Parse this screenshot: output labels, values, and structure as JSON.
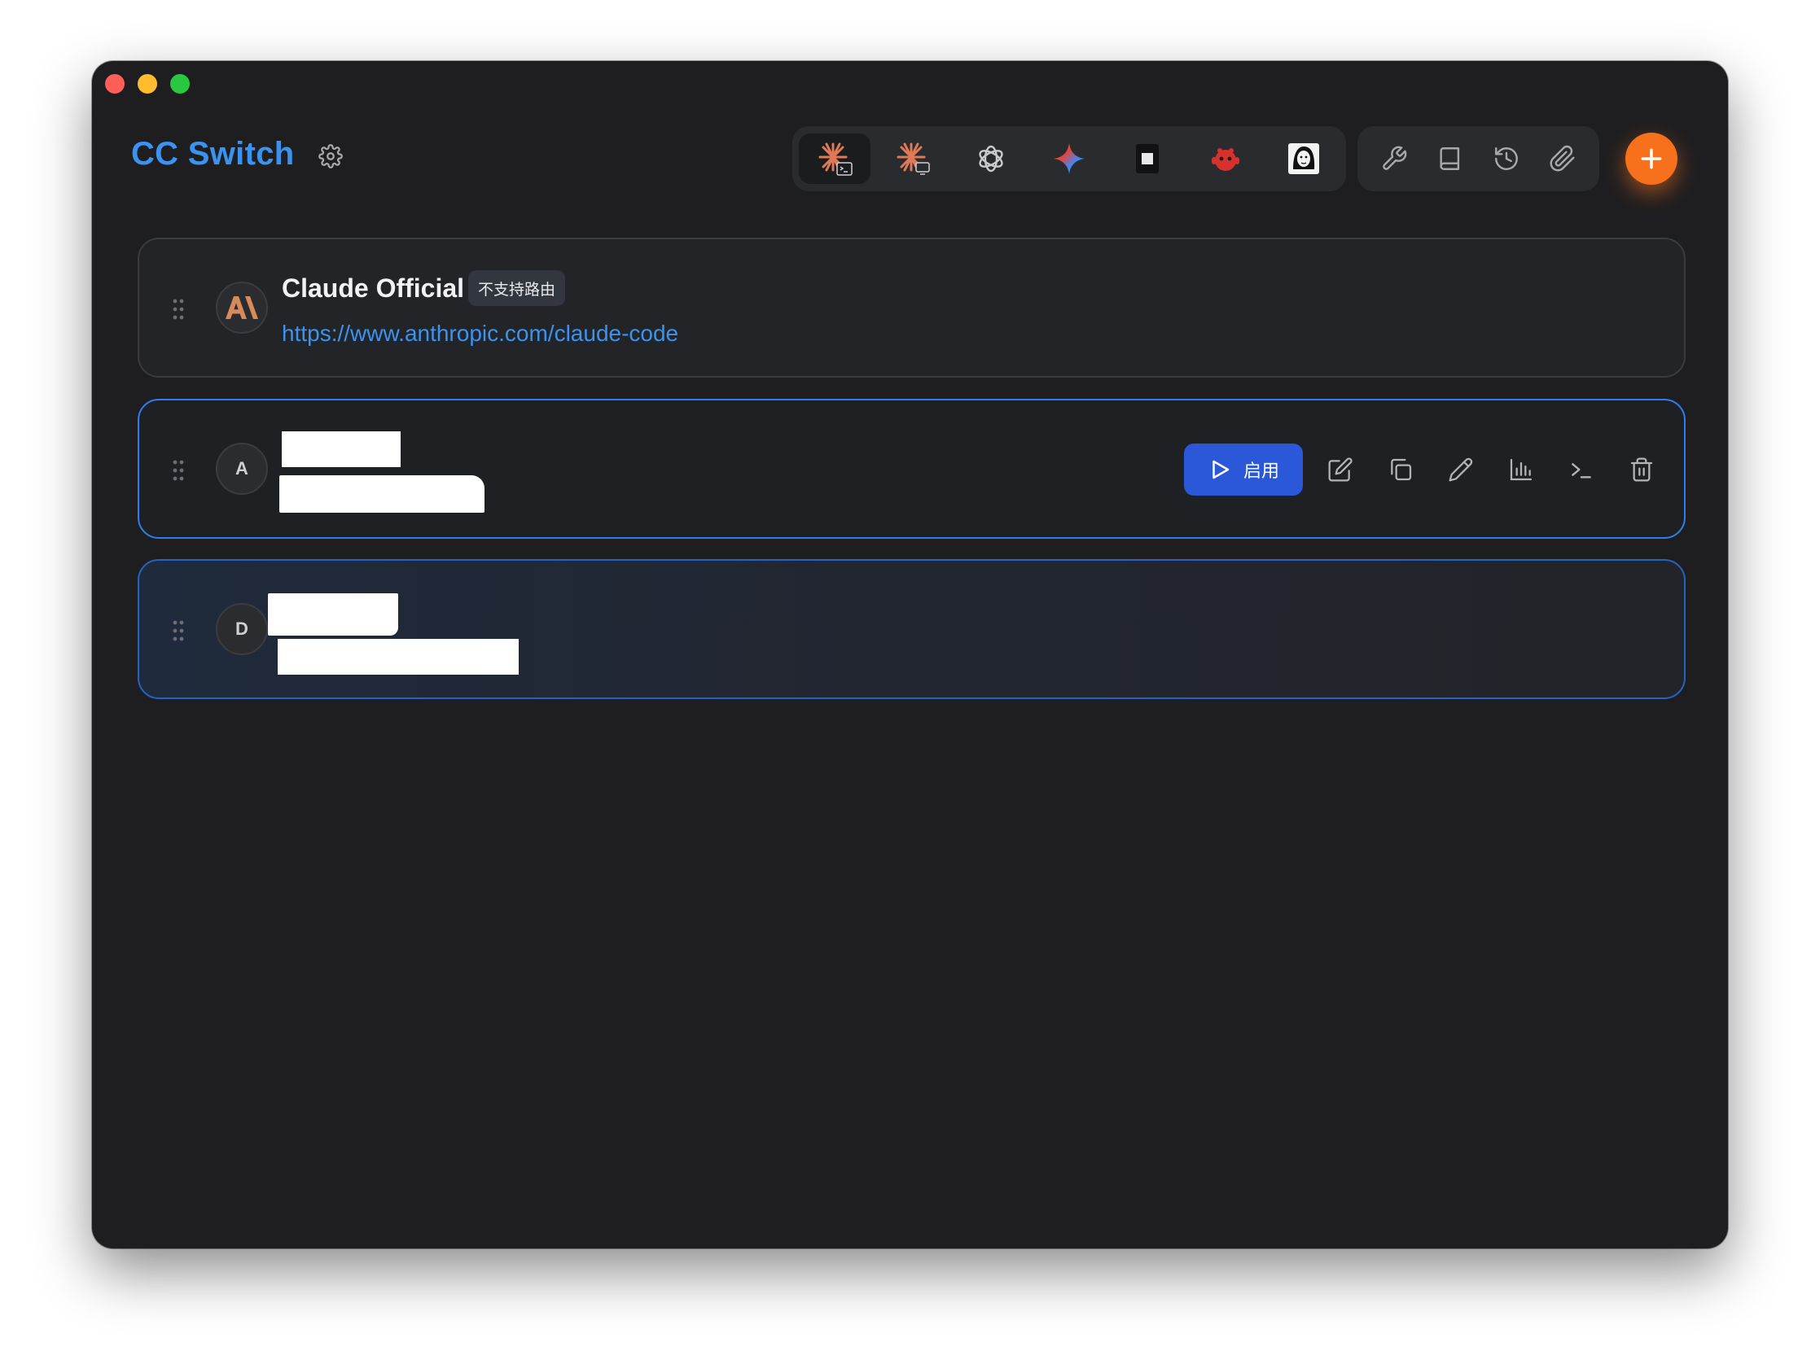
{
  "window": {
    "title": "CC Switch",
    "traffic_lights": [
      "close",
      "minimize",
      "maximize"
    ]
  },
  "header": {
    "settings_icon": "gear-icon",
    "app_switcher": [
      {
        "name": "claude-code",
        "icon": "claude-terminal-icon",
        "active": true
      },
      {
        "name": "claude-desktop",
        "icon": "claude-desktop-icon",
        "active": false
      },
      {
        "name": "openai-codex",
        "icon": "openai-icon",
        "active": false
      },
      {
        "name": "gemini",
        "icon": "gemini-icon",
        "active": false
      },
      {
        "name": "app-5",
        "icon": "square-icon",
        "active": false
      },
      {
        "name": "app-6",
        "icon": "red-mascot-icon",
        "active": false
      },
      {
        "name": "app-7",
        "icon": "portrait-icon",
        "active": false
      }
    ],
    "tools": [
      {
        "name": "tools",
        "icon": "wrench-icon"
      },
      {
        "name": "docs",
        "icon": "book-icon"
      },
      {
        "name": "history",
        "icon": "history-icon"
      },
      {
        "name": "attachments",
        "icon": "paperclip-icon"
      }
    ],
    "add_icon": "plus-icon"
  },
  "providers": [
    {
      "avatar": "",
      "avatar_icon": "anthropic-logo-icon",
      "name": "Claude Official",
      "badge": "不支持路由",
      "url": "https://www.anthropic.com/claude-code"
    },
    {
      "avatar": "A",
      "name": "",
      "url": "",
      "actions": {
        "enable_label": "启用",
        "icons": [
          "edit-icon",
          "copy-icon",
          "pencil-icon",
          "bar-chart-icon",
          "terminal-icon",
          "trash-icon"
        ]
      }
    },
    {
      "avatar": "D",
      "name": "",
      "url": ""
    }
  ],
  "colors": {
    "accent_blue": "#3b93f0",
    "enable_button": "#2a58d8",
    "add_button": "#f7711c",
    "window_bg": "#1e1e20"
  }
}
